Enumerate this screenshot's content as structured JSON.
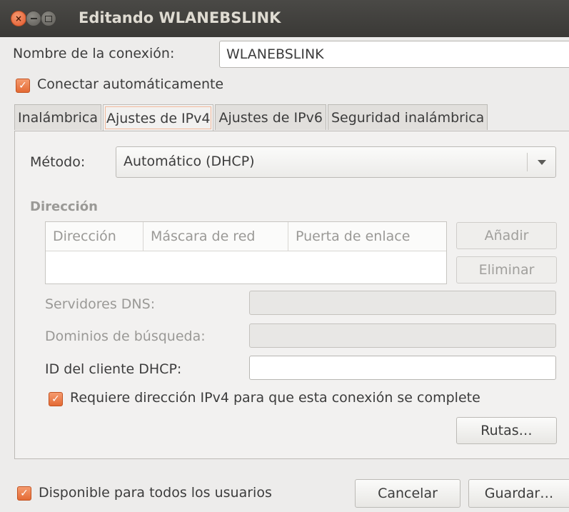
{
  "window": {
    "title": "Editando WLANEBSLINK"
  },
  "connection": {
    "name_label": "Nombre de la conexión:",
    "name_value": "WLANEBSLINK",
    "auto_connect_label": "Conectar automáticamente",
    "auto_connect_checked": true
  },
  "tabs": [
    {
      "label": "Inalámbrica",
      "active": false
    },
    {
      "label": "Ajustes de IPv4",
      "active": true
    },
    {
      "label": "Ajustes de IPv6",
      "active": false
    },
    {
      "label": "Seguridad inalámbrica",
      "active": false
    }
  ],
  "ipv4": {
    "method_label": "Método:",
    "method_value": "Automático (DHCP)",
    "address_section": "Dirección",
    "address_table": {
      "columns": [
        "Dirección",
        "Máscara de red",
        "Puerta de enlace"
      ],
      "rows": []
    },
    "add_button": "Añadir",
    "remove_button": "Eliminar",
    "dns_label": "Servidores DNS:",
    "dns_value": "",
    "search_domains_label": "Dominios de búsqueda:",
    "search_domains_value": "",
    "dhcp_client_id_label": "ID del cliente DHCP:",
    "dhcp_client_id_value": "",
    "require_ipv4_label": "Requiere dirección IPv4 para que esta conexión se complete",
    "require_ipv4_checked": true,
    "routes_button": "Rutas…"
  },
  "footer": {
    "all_users_label": "Disponible para todos los usuarios",
    "all_users_checked": true,
    "cancel_button": "Cancelar",
    "save_button": "Guardar…"
  },
  "colors": {
    "titlebar": "#3c3b37",
    "accent_checkbox": "#e8703a",
    "window_bg": "#edeceb"
  }
}
